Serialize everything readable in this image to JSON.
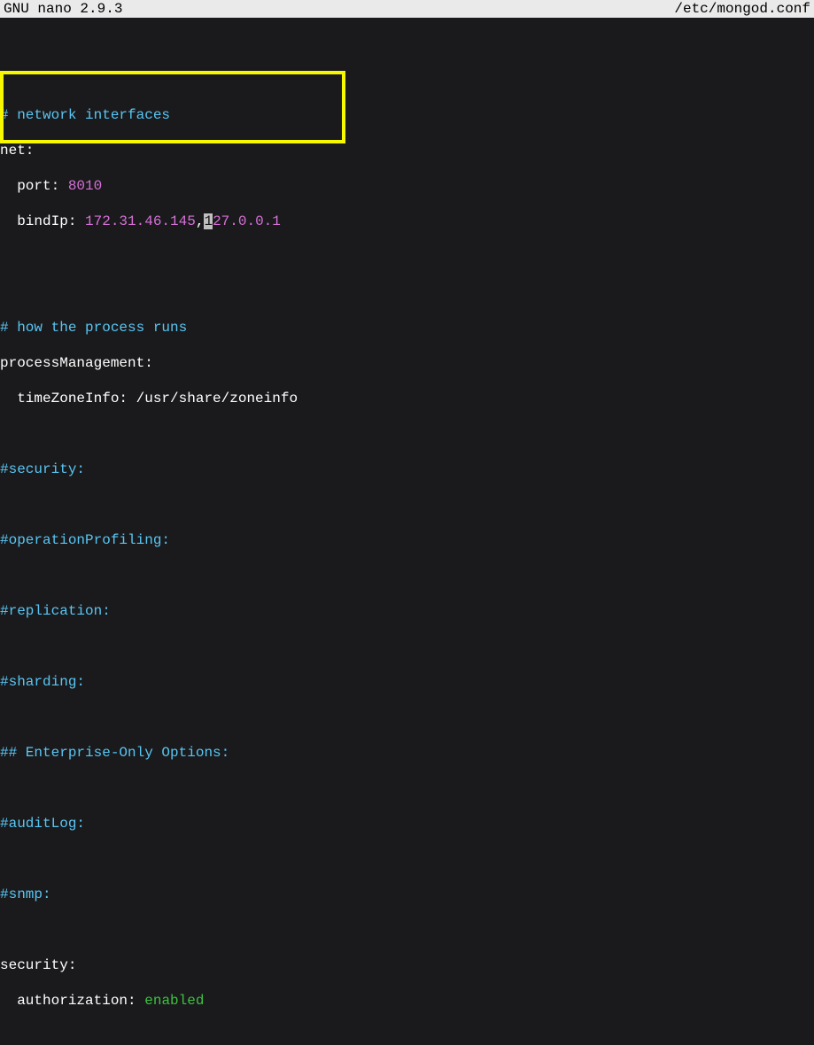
{
  "titlebar": {
    "app": "GNU nano 2.9.3",
    "filepath": "/etc/mongod.conf"
  },
  "content": {
    "comment_network": "# network interfaces",
    "net_key": "net:",
    "port_key": "  port: ",
    "port_value": "8010",
    "bindip_key": "  bindIp: ",
    "bindip_value1": "172.31.46.145",
    "bindip_comma": ",",
    "bindip_cursor": "1",
    "bindip_value2": "27.0.0.1",
    "comment_process": "# how the process runs",
    "processmgmt": "processManagement:",
    "timezone_key": "  timeZoneInfo: ",
    "timezone_value": "/usr/share/zoneinfo",
    "comment_security": "#security:",
    "comment_opprofile": "#operationProfiling:",
    "comment_replication": "#replication:",
    "comment_sharding": "#sharding:",
    "comment_enterprise": "## Enterprise-Only Options:",
    "comment_auditlog": "#auditLog:",
    "comment_snmp": "#snmp:",
    "security_key": "security:",
    "auth_key": "  authorization: ",
    "auth_value": "enabled"
  }
}
